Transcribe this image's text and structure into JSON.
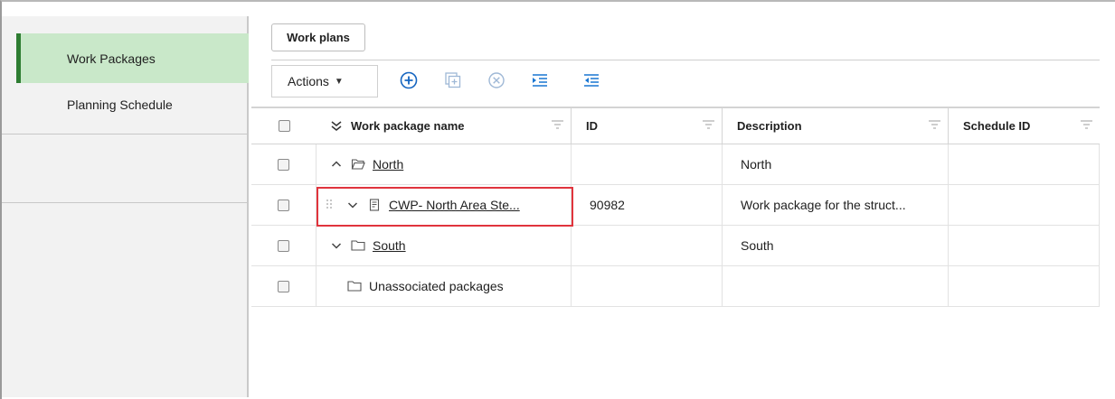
{
  "sidebar": {
    "items": [
      {
        "label": "Work Packages",
        "active": true
      },
      {
        "label": "Planning Schedule",
        "active": false
      }
    ]
  },
  "tabs": {
    "work_plans": "Work plans"
  },
  "toolbar": {
    "actions_label": "Actions",
    "icons": [
      "add-circle-icon",
      "copy-add-icon",
      "remove-circle-icon",
      "indent-icon",
      "outdent-icon"
    ]
  },
  "table": {
    "columns": [
      "Work package name",
      "ID",
      "Description",
      "Schedule ID"
    ],
    "rows": [
      {
        "name": "North",
        "id": "",
        "description": "North",
        "schedule_id": ""
      },
      {
        "name": "CWP- North Area Ste...",
        "id": "90982",
        "description": "Work package for the struct...",
        "schedule_id": ""
      },
      {
        "name": "South",
        "id": "",
        "description": "South",
        "schedule_id": ""
      },
      {
        "name": "Unassociated packages",
        "id": "",
        "description": "",
        "schedule_id": ""
      }
    ]
  },
  "colors": {
    "accent": "#2e7d32",
    "active_bg": "#c9e8c9",
    "icon_blue": "#1565c0",
    "highlight": "#e0343d"
  }
}
